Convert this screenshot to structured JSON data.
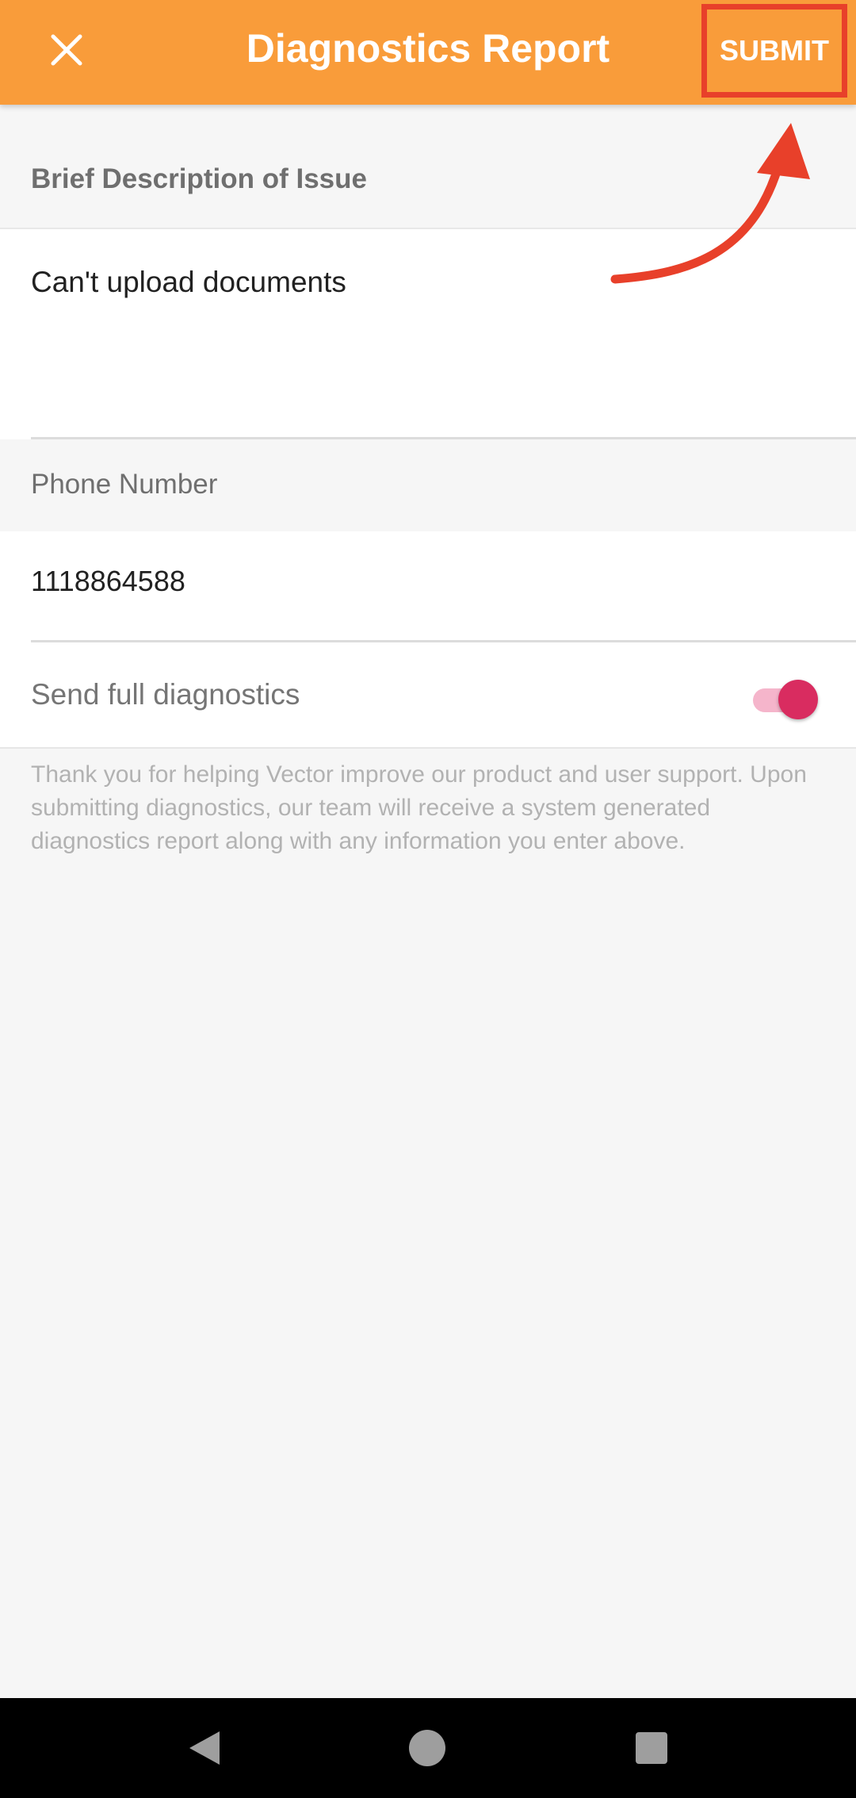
{
  "appbar": {
    "title": "Diagnostics Report",
    "submit_label": "SUBMIT",
    "close_icon": "close-icon",
    "background_color": "#f99c3a"
  },
  "description": {
    "header": "Brief Description of Issue",
    "value": "Can't upload documents"
  },
  "phone": {
    "header": "Phone Number",
    "value": "1118864588"
  },
  "diagnostics_toggle": {
    "label": "Send full diagnostics",
    "enabled": true,
    "thumb_color": "#d92c60",
    "track_color": "#f5b5cb"
  },
  "info": {
    "text": "Thank you for helping Vector improve our product and user support. Upon submitting diagnostics, our team will receive a system generated diagnostics report along with any information you enter above."
  },
  "annotation": {
    "highlight_color": "#e8402a"
  },
  "system_nav": {
    "icons": [
      "back-icon",
      "home-icon",
      "recents-icon"
    ]
  }
}
